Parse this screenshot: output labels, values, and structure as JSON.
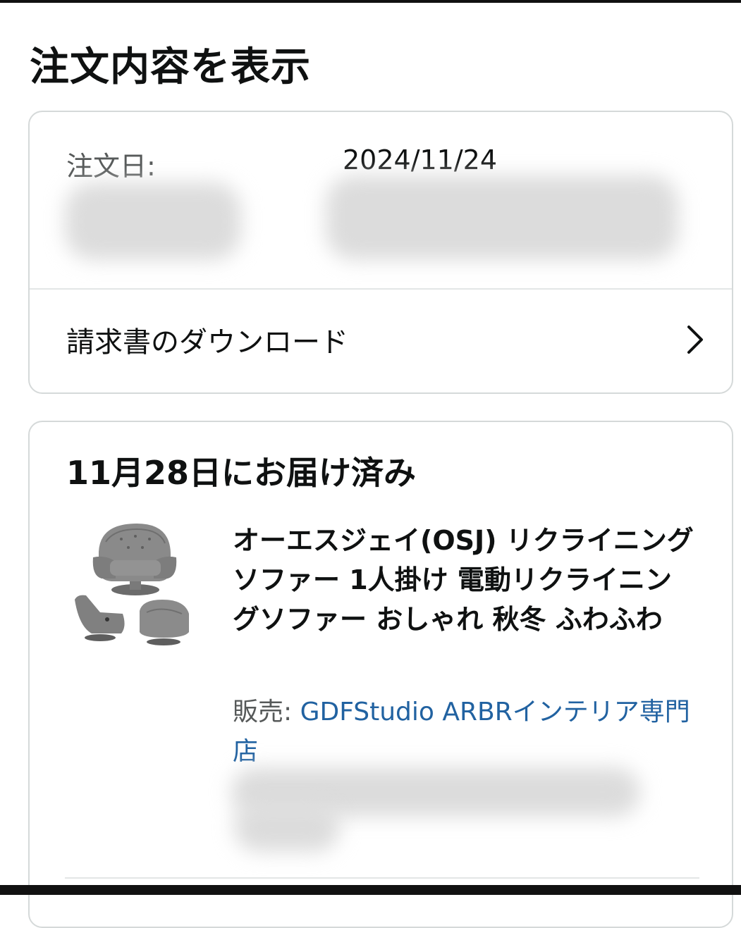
{
  "page": {
    "title": "注文内容を表示"
  },
  "order_summary": {
    "order_date_label": "注文日:",
    "order_date_value": "2024/11/24",
    "invoice_label": "請求書のダウンロード",
    "chevron_icon": "chevron-right-icon"
  },
  "shipment": {
    "status": "11月28日にお届け済み",
    "product": {
      "title": "オーエスジェイ(OSJ) リクライニングソファー 1人掛け 電動リクライニングソファー おしゃれ 秋冬 ふわふわ",
      "seller_prefix": "販売: ",
      "seller_name": "GDFStudio ARBRインテリア専門店",
      "image_icon": "recliner-chair-image"
    }
  },
  "colors": {
    "link": "#2162a1",
    "muted": "#565959",
    "border": "#d5d9d9"
  }
}
